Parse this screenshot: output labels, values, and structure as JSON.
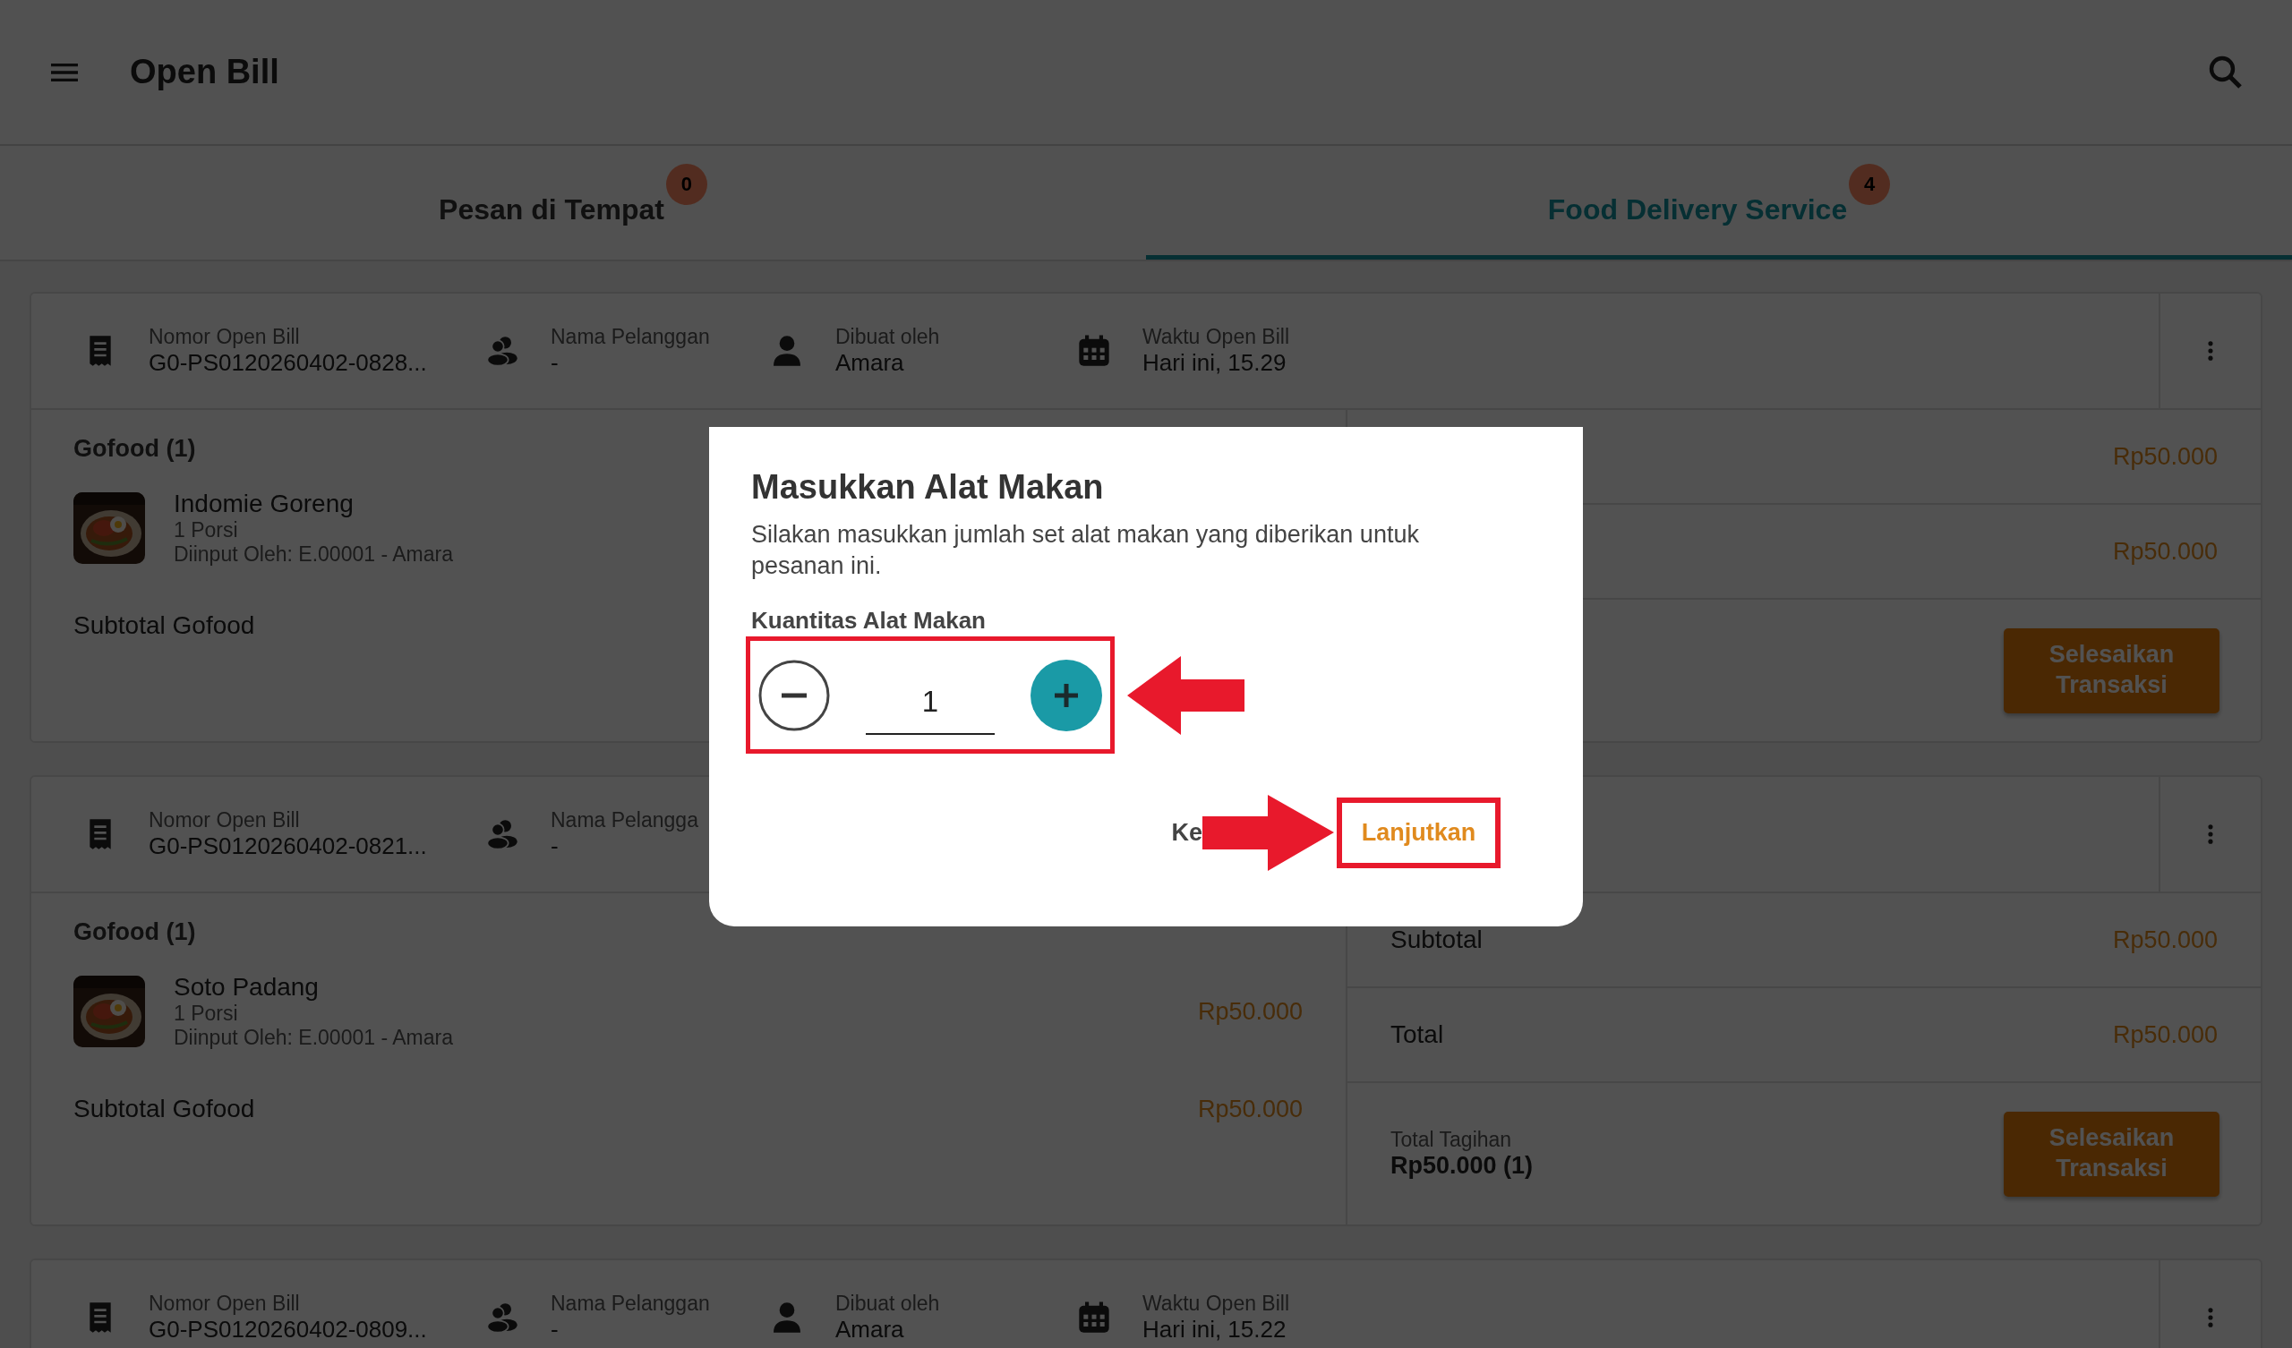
{
  "app_bar": {
    "title": "Open Bill"
  },
  "tabs": [
    {
      "label": "Pesan di Tempat",
      "badge": "0",
      "selected": false
    },
    {
      "label": "Food Delivery Service",
      "badge": "4",
      "selected": true
    }
  ],
  "bills": [
    {
      "fields": [
        {
          "kind": "receipt",
          "label": "Nomor Open Bill",
          "value": "G0-PS0120260402-0828..."
        },
        {
          "kind": "people",
          "label": "Nama Pelanggan",
          "value": "-"
        },
        {
          "kind": "person",
          "label": "Dibuat oleh",
          "value": "Amara"
        },
        {
          "kind": "calendar",
          "label": "Waktu Open Bill",
          "value": "Hari ini, 15.29"
        }
      ],
      "groups": [
        {
          "title": "Gofood (1)",
          "items": [
            {
              "name": "Indomie Goreng",
              "qty": "1 Porsi",
              "input_by": "Diinput Oleh: E.00001 - Amara"
            }
          ],
          "subtotal_label": "Subtotal Gofood"
        }
      ],
      "summary": [
        {
          "kind": "row",
          "value": "Rp50.000"
        },
        {
          "kind": "row",
          "value": "Rp50.000"
        },
        {
          "kind": "action",
          "button": "Selesaikan Transaksi"
        }
      ]
    },
    {
      "fields": [
        {
          "kind": "receipt",
          "label": "Nomor Open Bill",
          "value": "G0-PS0120260402-0821..."
        },
        {
          "kind": "people",
          "label": "Nama Pelangga",
          "value": "-"
        }
      ],
      "groups": [
        {
          "title": "Gofood (1)",
          "items": [
            {
              "name": "Soto Padang",
              "qty": "1 Porsi",
              "input_by": "Diinput Oleh: E.00001 - Amara",
              "price": "Rp50.000"
            }
          ],
          "subtotal_label": "Subtotal Gofood",
          "subtotal_value": "Rp50.000"
        }
      ],
      "summary": [
        {
          "kind": "row",
          "label": "Subtotal",
          "value": "Rp50.000"
        },
        {
          "kind": "row",
          "label": "Total",
          "value": "Rp50.000"
        },
        {
          "kind": "action",
          "label": "Total Tagihan",
          "value": "Rp50.000 (1)",
          "button": "Selesaikan Transaksi"
        }
      ]
    },
    {
      "fields": [
        {
          "kind": "receipt",
          "label": "Nomor Open Bill",
          "value": "G0-PS0120260402-0809..."
        },
        {
          "kind": "people",
          "label": "Nama Pelanggan",
          "value": "-"
        },
        {
          "kind": "person",
          "label": "Dibuat oleh",
          "value": "Amara"
        },
        {
          "kind": "calendar",
          "label": "Waktu Open Bill",
          "value": "Hari ini, 15.22"
        }
      ]
    }
  ],
  "dialog": {
    "title": "Masukkan Alat Makan",
    "message": "Silakan masukkan jumlah set alat makan yang diberikan untuk pesanan ini.",
    "field_label": "Kuantitas Alat Makan",
    "quantity": "1",
    "buttons": [
      {
        "label": "Ke",
        "kind": "secondary"
      },
      {
        "label": "Lanjutkan",
        "kind": "primary"
      }
    ]
  }
}
